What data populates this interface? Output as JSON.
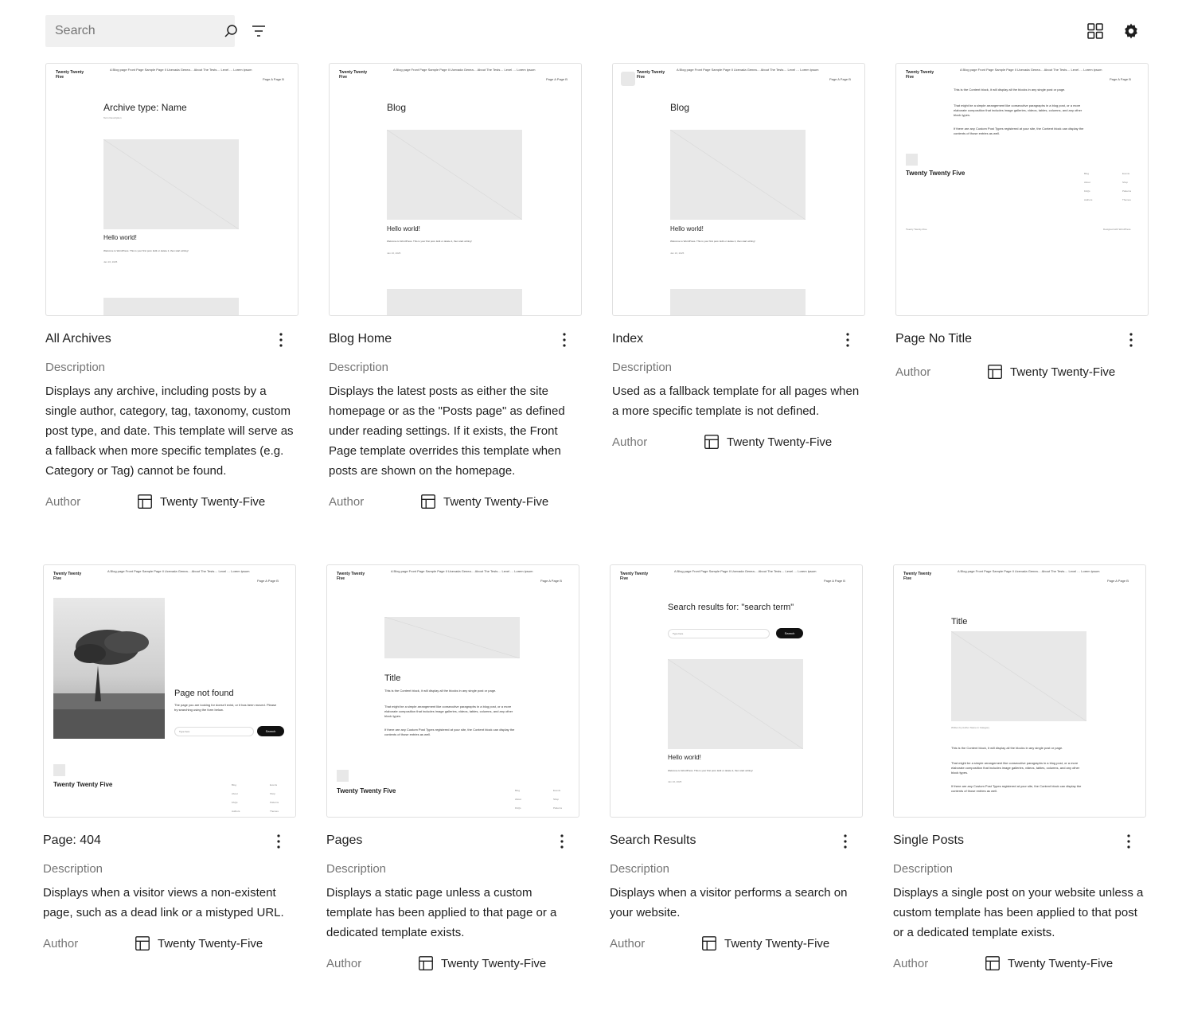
{
  "toolbar": {
    "search_placeholder": "Search",
    "icons": [
      "search-icon",
      "filter-icon",
      "grid-view-icon",
      "settings-icon"
    ]
  },
  "labels": {
    "description": "Description",
    "author": "Author"
  },
  "cards": [
    {
      "title": "All Archives",
      "description": "Displays any archive, including posts by a single author, category, tag, taxonomy, custom post type, and date. This template will serve as a fallback when more specific templates (e.g. Category or Tag) cannot be found.",
      "author": "Twenty Twenty-Five",
      "preview": {
        "heading": "Archive type: Name",
        "subheading": "Term Description",
        "post_title": "Hello world!",
        "post_excerpt": "Welcome to WordPress. This is your first post. Edit or delete it, then start writing!",
        "post_date": "Jan 16, 2025"
      }
    },
    {
      "title": "Blog Home",
      "description": "Displays the latest posts as either the site homepage or as the \"Posts page\" as defined under reading settings. If it exists, the Front Page template overrides this template when posts are shown on the homepage.",
      "author": "Twenty Twenty-Five",
      "preview": {
        "heading": "Blog",
        "post_title": "Hello world!",
        "post_excerpt": "Welcome to WordPress. This is your first post. Edit or delete it, then start writing!",
        "post_date": "Jan 16, 2025"
      }
    },
    {
      "title": "Index",
      "description": "Used as a fallback template for all pages when a more specific template is not defined.",
      "author": "Twenty Twenty-Five",
      "preview": {
        "heading": "Blog",
        "post_title": "Hello world!",
        "post_excerpt": "Welcome to WordPress. This is your first post. Edit or delete it, then start writing!",
        "post_date": "Jan 16, 2025"
      }
    },
    {
      "title": "Page No Title",
      "description": "",
      "author": "Twenty Twenty-Five",
      "preview": {
        "p1": "This is the Content block, it will display all the blocks in any single post or page.",
        "p2": "That might be a simple arrangement like consecutive paragraphs in a blog post, or a more elaborate composition that includes image galleries, videos, tables, columns, and any other block types.",
        "p3": "If there are any Custom Post Types registered at your site, the Content block can display the contents of those entries as well.",
        "footer_logo": "Twenty Twenty Five",
        "footer_left": "Twenty Twenty-Five",
        "footer_right": "Designed with WordPress"
      }
    },
    {
      "title": "Page: 404",
      "description": "Displays when a visitor views a non-existent page, such as a dead link or a mistyped URL.",
      "author": "Twenty Twenty-Five",
      "preview": {
        "heading": "Page not found",
        "body": "The page you are looking for doesn't exist, or it has been moved. Please try searching using the form below.",
        "search_placeholder": "Type here",
        "search_button": "Search",
        "footer_logo": "Twenty Twenty Five"
      }
    },
    {
      "title": "Pages",
      "description": "Displays a static page unless a custom template has been applied to that page or a dedicated template exists.",
      "author": "Twenty Twenty-Five",
      "preview": {
        "heading": "Title",
        "p1": "This is the Content block, it will display all the blocks in any single post or page.",
        "p2": "That might be a simple arrangement like consecutive paragraphs in a blog post, or a more elaborate composition that includes image galleries, videos, tables, columns, and any other block types.",
        "p3": "If there are any Custom Post Types registered at your site, the Content block can display the contents of those entries as well.",
        "footer_logo": "Twenty Twenty Five"
      }
    },
    {
      "title": "Search Results",
      "description": "Displays when a visitor performs a search on your website.",
      "author": "Twenty Twenty-Five",
      "preview": {
        "heading": "Search results for: \"search term\"",
        "search_placeholder": "Type here",
        "search_button": "Search",
        "post_title": "Hello world!",
        "post_excerpt": "Welcome to WordPress. This is your first post. Edit or delete it, then start writing!",
        "post_date": "Jan 16, 2025"
      }
    },
    {
      "title": "Single Posts",
      "description": "Displays a single post on your website unless a custom template has been applied to that post or a dedicated template exists.",
      "author": "Twenty Twenty-Five",
      "preview": {
        "heading": "Title",
        "meta": "Written by Author Name in Category",
        "p1": "This is the Content block, it will display all the blocks in any single post or page.",
        "p2": "That might be a simple arrangement like consecutive paragraphs in a blog post, or a more elaborate composition that includes image galleries, videos, tables, columns, and any other block types.",
        "p3": "If there are any Custom Post Types registered at your site, the Content block can display the contents of those entries as well."
      }
    }
  ],
  "mini_header": {
    "logo": "Twenty Twenty Five",
    "nav": "A Blog page   Front Page   Sample Page   Il Ucevada Genea…   About The Tests…   Level …   Lorem ipsum",
    "nav2": "Page A   Page B"
  },
  "mini_footer_links": {
    "col1": [
      "Blog",
      "About",
      "FAQs",
      "Authors"
    ],
    "col2": [
      "Events",
      "Shop",
      "Patterns",
      "Themes"
    ]
  }
}
